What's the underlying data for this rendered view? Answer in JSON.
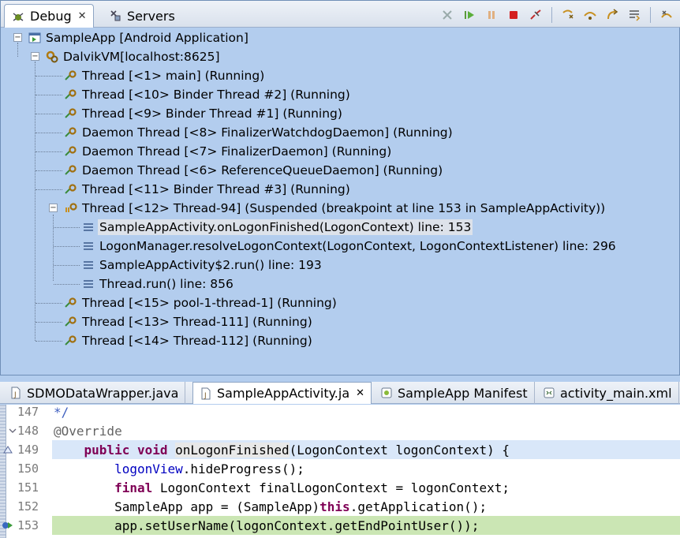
{
  "debug_view": {
    "tabs": [
      {
        "label": "Debug",
        "icon": "debug-icon",
        "active": true
      },
      {
        "label": "Servers",
        "icon": "servers-icon",
        "active": false
      }
    ],
    "toolbar": [
      "remove-terminated-icon",
      "resume-icon",
      "suspend-icon",
      "terminate-icon",
      "disconnect-icon",
      "step-into-icon",
      "step-over-icon",
      "step-return-icon",
      "drop-to-frame-icon",
      "use-step-filters-icon"
    ],
    "tree": [
      {
        "label": "SampleApp [Android Application]",
        "icon": "launch-icon"
      },
      {
        "label": "DalvikVM[localhost:8625]",
        "icon": "debug-target-icon"
      },
      {
        "label": "Thread [<1> main] (Running)",
        "icon": "thread-running-icon"
      },
      {
        "label": "Thread [<10> Binder Thread #2] (Running)",
        "icon": "thread-running-icon"
      },
      {
        "label": "Thread [<9> Binder Thread #1] (Running)",
        "icon": "thread-running-icon"
      },
      {
        "label": "Daemon Thread [<8> FinalizerWatchdogDaemon] (Running)",
        "icon": "thread-running-icon"
      },
      {
        "label": "Daemon Thread [<7> FinalizerDaemon] (Running)",
        "icon": "thread-running-icon"
      },
      {
        "label": "Daemon Thread [<6> ReferenceQueueDaemon] (Running)",
        "icon": "thread-running-icon"
      },
      {
        "label": "Thread [<11> Binder Thread #3] (Running)",
        "icon": "thread-running-icon"
      },
      {
        "label": "Thread [<12> Thread-94] (Suspended (breakpoint at line 153 in SampleAppActivity))",
        "icon": "thread-suspended-icon"
      },
      {
        "label": "SampleAppActivity.onLogonFinished(LogonContext) line: 153",
        "icon": "stack-frame-icon"
      },
      {
        "label": "LogonManager.resolveLogonContext(LogonContext, LogonContextListener) line: 296",
        "icon": "stack-frame-icon"
      },
      {
        "label": "SampleAppActivity$2.run() line: 193",
        "icon": "stack-frame-icon"
      },
      {
        "label": "Thread.run() line: 856",
        "icon": "stack-frame-icon"
      },
      {
        "label": "Thread [<15> pool-1-thread-1] (Running)",
        "icon": "thread-running-icon"
      },
      {
        "label": "Thread [<13> Thread-111] (Running)",
        "icon": "thread-running-icon"
      },
      {
        "label": "Thread [<14> Thread-112] (Running)",
        "icon": "thread-running-icon"
      }
    ]
  },
  "editor": {
    "tabs": [
      {
        "label": "SDMODataWrapper.java",
        "icon": "java-file-icon"
      },
      {
        "label": "SampleAppActivity.ja",
        "icon": "java-file-icon"
      },
      {
        "label": "SampleApp Manifest",
        "icon": "android-manifest-icon"
      },
      {
        "label": "activity_main.xml",
        "icon": "xml-file-icon"
      }
    ],
    "lines": [
      {
        "num": "147",
        "parts": [
          [
            "cmt",
            "*/"
          ]
        ]
      },
      {
        "num": "148",
        "parts": [
          [
            "ann",
            "@Override"
          ]
        ]
      },
      {
        "num": "149",
        "parts": [
          [
            "",
            "    "
          ],
          [
            "kw",
            "public"
          ],
          [
            "",
            " "
          ],
          [
            "kw",
            "void"
          ],
          [
            "",
            " "
          ],
          [
            "mth-hl",
            "onLogonFinished"
          ],
          [
            "",
            "(LogonContext logonContext) {"
          ]
        ]
      },
      {
        "num": "150",
        "parts": [
          [
            "",
            "        "
          ],
          [
            "fld",
            "logonView"
          ],
          [
            "",
            ".hideProgress();"
          ]
        ]
      },
      {
        "num": "151",
        "parts": [
          [
            "",
            "        "
          ],
          [
            "kw",
            "final"
          ],
          [
            "",
            " LogonContext finalLogonContext = logonContext;"
          ]
        ]
      },
      {
        "num": "152",
        "parts": [
          [
            "",
            "        SampleApp app = (SampleApp)"
          ],
          [
            "kw",
            "this"
          ],
          [
            "",
            ".getApplication();"
          ]
        ]
      },
      {
        "num": "153",
        "parts": [
          [
            "",
            "        app.setUserName(logonContext.getEndPointUser());"
          ]
        ]
      }
    ]
  }
}
